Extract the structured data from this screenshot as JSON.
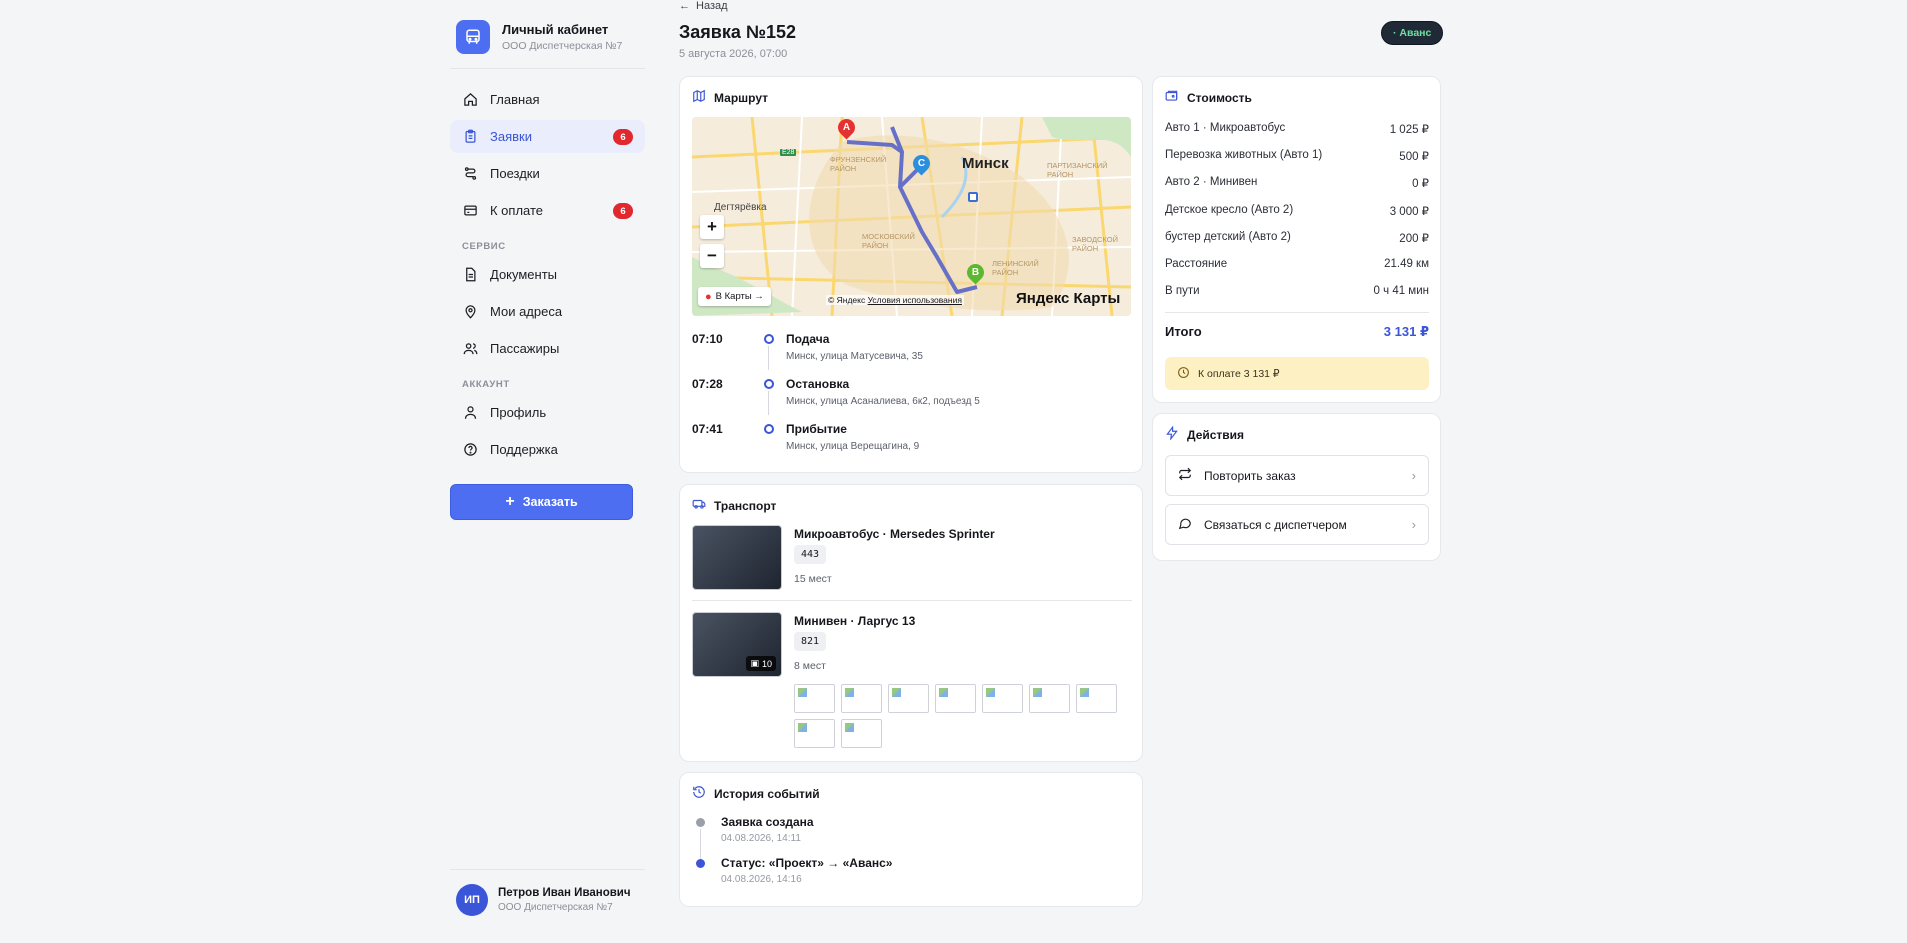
{
  "sidebar": {
    "brand_title": "Личный кабинет",
    "brand_sub": "ООО Диспетчерская №7",
    "items": [
      {
        "label": "Главная",
        "icon": "home-icon"
      },
      {
        "label": "Заявки",
        "icon": "clipboard-icon",
        "badge": "6",
        "active": true
      },
      {
        "label": "Поездки",
        "icon": "route-icon"
      },
      {
        "label": "К оплате",
        "icon": "card-icon",
        "badge": "6"
      }
    ],
    "section_service": "СЕРВИС",
    "service_items": [
      {
        "label": "Документы",
        "icon": "document-icon"
      },
      {
        "label": "Мои адреса",
        "icon": "pin-icon"
      },
      {
        "label": "Пассажиры",
        "icon": "users-icon"
      }
    ],
    "section_account": "АККАУНТ",
    "account_items": [
      {
        "label": "Профиль",
        "icon": "user-icon"
      },
      {
        "label": "Поддержка",
        "icon": "help-icon"
      }
    ],
    "order_button": "Заказать",
    "user": {
      "initials": "ИП",
      "name": "Петров Иван Иванович",
      "org": "ООО Диспетчерская №7"
    }
  },
  "header": {
    "back": "Назад",
    "title": "Заявка №152",
    "date": "5 августа 2026, 07:00",
    "status": "· Аванс"
  },
  "route": {
    "title": "Маршрут",
    "map": {
      "city": "Минск",
      "labels": [
        "ФРУНЗЕНСКИЙ РАЙОН",
        "ПАРТИЗАНСКИЙ РАЙОН",
        "МОСКОВСКИЙ РАЙОН",
        "ЛЕНИНСКИЙ РАЙОН",
        "ЗАВОДСКОЙ РАЙОН",
        "Дегтярёвка",
        "E28"
      ],
      "open_in_maps": "В Карты →",
      "copyright": "© Яндекс",
      "terms": "Условия использования",
      "logo": "Яндекс Карты",
      "markers": [
        "A",
        "C",
        "B"
      ]
    },
    "stops": [
      {
        "time": "07:10",
        "title": "Подача",
        "address": "Минск, улица Матусевича, 35"
      },
      {
        "time": "07:28",
        "title": "Остановка",
        "address": "Минск, улица Асаналиева, 6к2, подъезд 5"
      },
      {
        "time": "07:41",
        "title": "Прибытие",
        "address": "Минск, улица Верещагина, 9"
      }
    ]
  },
  "transport": {
    "title": "Транспорт",
    "vehicles": [
      {
        "name": "Микроавтобус · Mersedes Sprinter",
        "plate": "443",
        "seats": "15 мест"
      },
      {
        "name": "Минивен · Ларгус 13",
        "plate": "821",
        "seats": "8 мест",
        "photos": "10"
      }
    ]
  },
  "history": {
    "title": "История событий",
    "events": [
      {
        "title": "Заявка создана",
        "date": "04.08.2026, 14:11",
        "color": "#9ba0a8"
      },
      {
        "title": "Статус: «Проект» → «Аванс»",
        "date": "04.08.2026, 14:16",
        "color": "#3a55d8"
      }
    ]
  },
  "cost": {
    "title": "Стоимость",
    "rows": [
      {
        "label": "Авто 1 · Микроавтобус",
        "value": "1 025 ₽"
      },
      {
        "label": "Перевозка животных (Авто 1)",
        "value": "500 ₽"
      },
      {
        "label": "Авто 2 · Минивен",
        "value": "0 ₽"
      },
      {
        "label": "Детское кресло (Авто 2)",
        "value": "3 000 ₽"
      },
      {
        "label": "бустер детский (Авто 2)",
        "value": "200 ₽"
      },
      {
        "label": "Расстояние",
        "value": "21.49 км"
      },
      {
        "label": "В пути",
        "value": "0 ч 41 мин"
      }
    ],
    "total_label": "Итого",
    "total_value": "3 131 ₽",
    "due": "К оплате 3 131 ₽"
  },
  "actions": {
    "title": "Действия",
    "repeat": "Повторить заказ",
    "contact": "Связаться с диспетчером"
  },
  "colors": {
    "accent": "#4e6ef2",
    "badge": "#e0282e",
    "status_bg": "#1f2a36",
    "status_fg": "#6fe0a3"
  }
}
